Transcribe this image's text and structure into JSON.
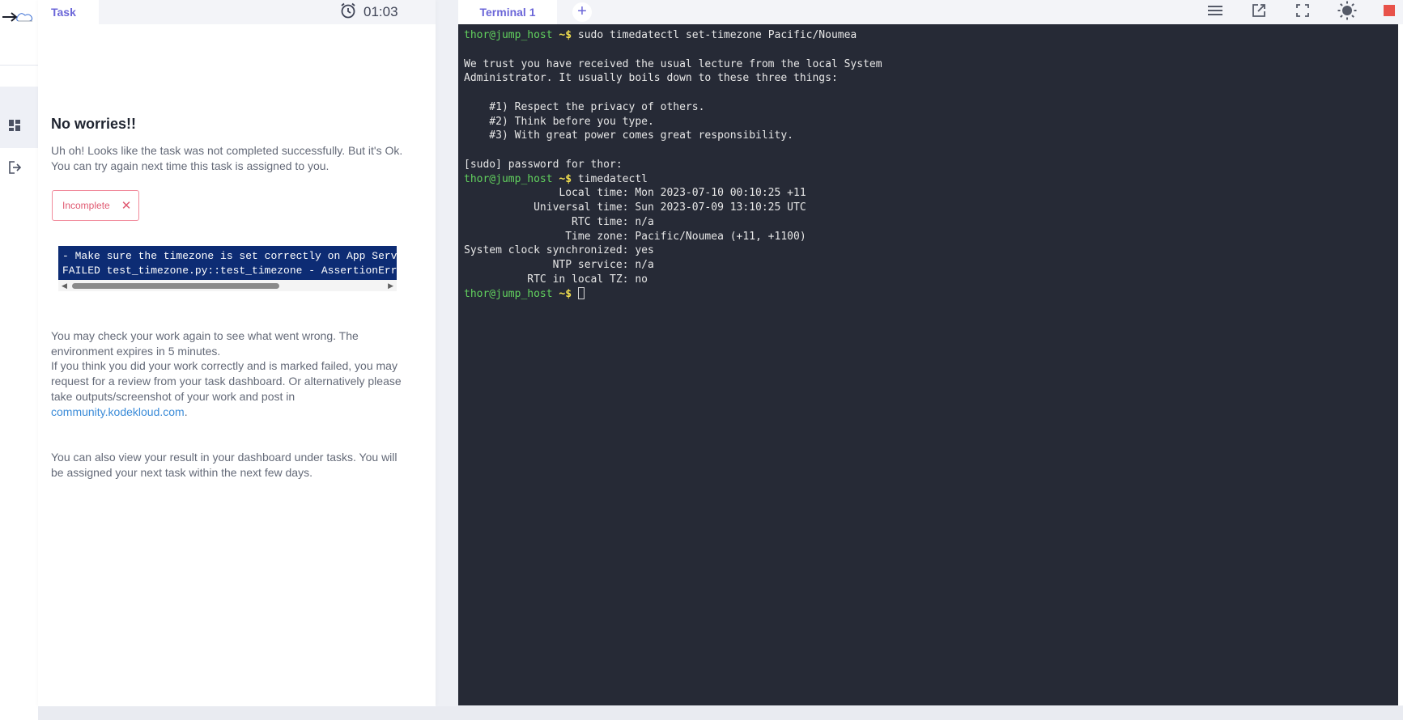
{
  "rail": {
    "logo_icon": "kodekloud-logo",
    "items": [
      {
        "icon": "dashboard-icon"
      },
      {
        "icon": "logout-icon"
      }
    ]
  },
  "task_panel": {
    "tab_label": "Task",
    "timer": "01:03",
    "heading": "No worries!!",
    "intro": "Uh oh! Looks like the task was not completed successfully. But it's Ok. You can try again next time this task is assigned to you.",
    "status_badge": {
      "label": "Incomplete",
      "close": "✕"
    },
    "log_lines": [
      "- Make sure the timezone is set correctly on App Serve",
      "FAILED test_timezone.py::test_timezone - AssertionErro"
    ],
    "scroll_left": "◀",
    "scroll_right": "▶",
    "check_work": "You may check your work again to see what went wrong. The environment expires in 5 minutes.",
    "review_text": "If you think you did your work correctly and is marked failed, you may request for a review from your task dashboard. Or alternatively please take outputs/screenshot of your work and post in ",
    "review_link": "community.kodekloud.com",
    "review_end": ".",
    "dashboard_note": "You can also view your result in your dashboard under tasks. You will be assigned your next task within the next few days."
  },
  "terminal": {
    "tab_label": "Terminal 1",
    "add_tab": "+",
    "toolbar_icons": [
      "menu-icon",
      "external-link-icon",
      "fullscreen-icon",
      "theme-toggle-icon",
      "stop-icon"
    ],
    "colors": {
      "background": "#262a36",
      "prompt": "#62d25e",
      "dollar": "#f3e04f",
      "text": "#e7e7e7"
    },
    "lines": [
      {
        "user": "thor@jump_host",
        "dir": " ~",
        "sym": "$",
        "cmd": " sudo timedatectl set-timezone Pacific/Noumea"
      },
      {
        "text": ""
      },
      {
        "text": "We trust you have received the usual lecture from the local System"
      },
      {
        "text": "Administrator. It usually boils down to these three things:"
      },
      {
        "text": ""
      },
      {
        "text": "    #1) Respect the privacy of others."
      },
      {
        "text": "    #2) Think before you type."
      },
      {
        "text": "    #3) With great power comes great responsibility."
      },
      {
        "text": ""
      },
      {
        "text": "[sudo] password for thor:"
      },
      {
        "user": "thor@jump_host",
        "dir": " ~",
        "sym": "$",
        "cmd": " timedatectl"
      },
      {
        "text": "               Local time: Mon 2023-07-10 00:10:25 +11"
      },
      {
        "text": "           Universal time: Sun 2023-07-09 13:10:25 UTC"
      },
      {
        "text": "                 RTC time: n/a"
      },
      {
        "text": "                Time zone: Pacific/Noumea (+11, +1100)"
      },
      {
        "text": "System clock synchronized: yes"
      },
      {
        "text": "              NTP service: n/a"
      },
      {
        "text": "          RTC in local TZ: no"
      },
      {
        "user": "thor@jump_host",
        "dir": " ~",
        "sym": "$",
        "cmd": " ",
        "cursor": true
      }
    ]
  }
}
